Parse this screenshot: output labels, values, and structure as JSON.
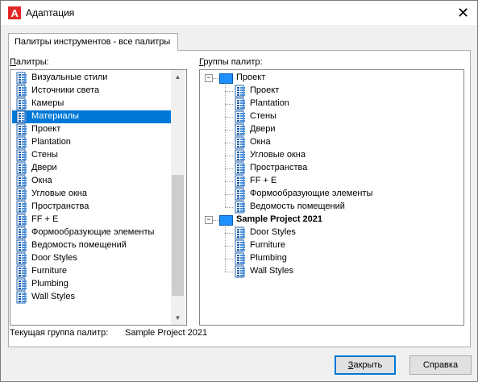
{
  "window": {
    "title": "Адаптация",
    "close_glyph": "✕"
  },
  "tab": {
    "label": "Палитры инструментов - все палитры"
  },
  "palettes": {
    "label": "Палитры:",
    "items": [
      "Визуальные стили",
      "Источники света",
      "Камеры",
      "Материалы",
      "Проект",
      "Plantation",
      "Стены",
      "Двери",
      "Окна",
      "Угловые окна",
      "Пространства",
      "FF + E",
      "Формообразующие элементы",
      "Ведомость помещений",
      "Door Styles",
      "Furniture",
      "Plumbing",
      "Wall Styles"
    ],
    "selected_index": 3,
    "scroll_up_glyph": "▲",
    "scroll_down_glyph": "▼"
  },
  "groups": {
    "label": "Группы палитр:",
    "tree": [
      {
        "name": "Проект",
        "bold": false,
        "children": [
          "Проект",
          "Plantation",
          "Стены",
          "Двери",
          "Окна",
          "Угловые окна",
          "Пространства",
          "FF + E",
          "Формообразующие элементы",
          "Ведомость помещений"
        ]
      },
      {
        "name": "Sample Project 2021",
        "bold": true,
        "children": [
          "Door Styles",
          "Furniture",
          "Plumbing",
          "Wall Styles"
        ]
      }
    ],
    "expander_glyph": "−"
  },
  "current_group": {
    "label": "Текущая группа палитр:",
    "value": "Sample Project 2021"
  },
  "buttons": {
    "close_label": "Закрыть",
    "help_label": "Справка"
  },
  "colors": {
    "selection": "#0078d7",
    "group_icon": "#1e90ff",
    "app_icon": "#e32727"
  },
  "icons": {
    "palette": "tool-palette-icon",
    "group": "palette-group-icon",
    "app": "autocad-logo-icon"
  }
}
